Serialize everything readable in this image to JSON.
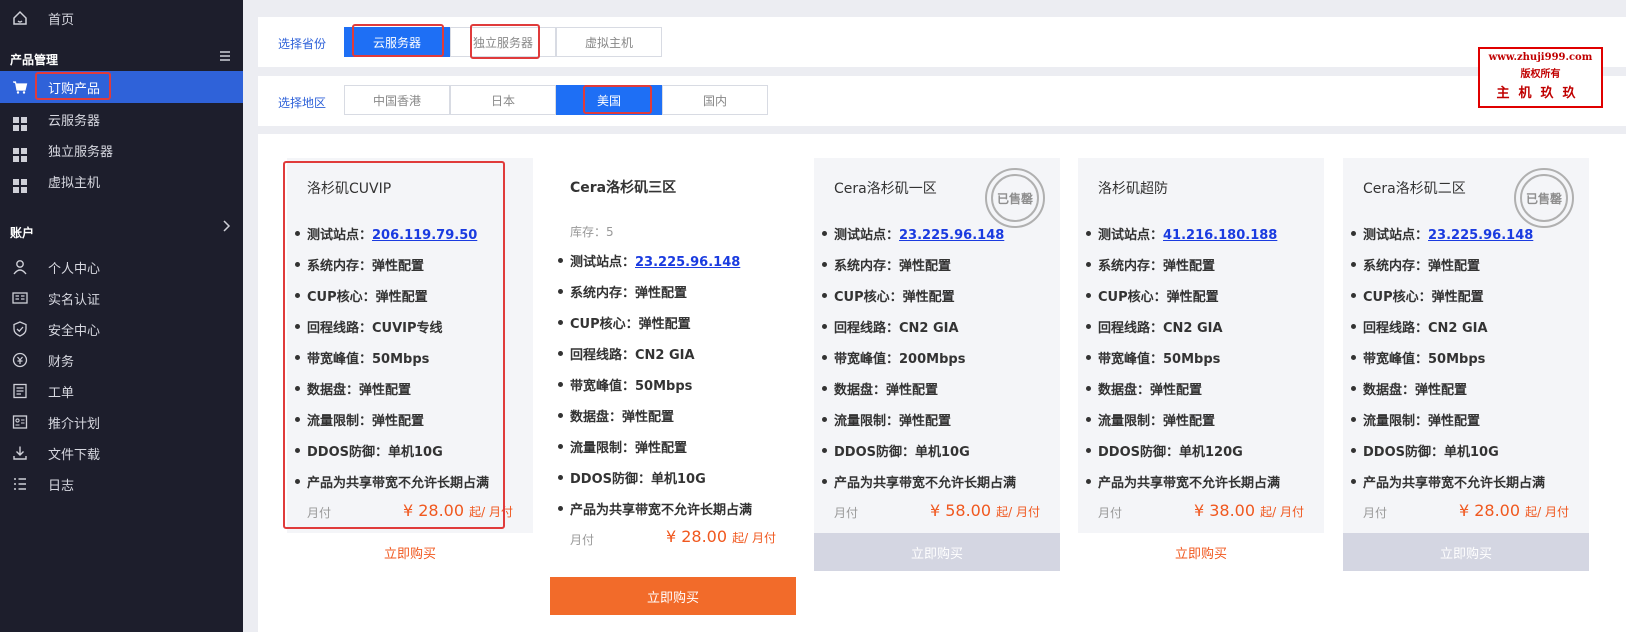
{
  "sidebar": {
    "home": "首页",
    "product_section": "产品管理",
    "items": [
      {
        "label": "订购产品"
      },
      {
        "label": "云服务器"
      },
      {
        "label": "独立服务器"
      },
      {
        "label": "虚拟主机"
      }
    ],
    "account_section": "账户",
    "account_items": [
      {
        "label": "个人中心"
      },
      {
        "label": "实名认证"
      },
      {
        "label": "安全中心"
      },
      {
        "label": "财务"
      },
      {
        "label": "工单"
      },
      {
        "label": "推介计划"
      },
      {
        "label": "文件下载"
      },
      {
        "label": "日志"
      }
    ]
  },
  "filters": {
    "type_label": "选择省份",
    "type_options": [
      "云服务器",
      "独立服务器",
      "虚拟主机"
    ],
    "type_selected": "云服务器",
    "region_label": "选择地区",
    "region_options": [
      "中国香港",
      "日本",
      "美国",
      "国内"
    ],
    "region_selected": "美国"
  },
  "watermark": {
    "line1": "www.zhuji999.com",
    "line2": "版权所有",
    "line3": "主机玖玖"
  },
  "spec_labels": {
    "site": "测试站点：",
    "memory": "系统内存：",
    "cpu": "CUP核心：",
    "route": "回程线路：",
    "bandwidth": "带宽峰值：",
    "disk": "数据盘：",
    "traffic": "流量限制：",
    "ddos": "DDOS防御：",
    "note": "产品为共享带宽不允许长期占满"
  },
  "price_suffix": "起/ 月付",
  "cards": [
    {
      "title": "洛杉矶CUVIP",
      "stock": "",
      "site": "206.119.79.50",
      "memory": "弹性配置",
      "cpu": "弹性配置",
      "route": "CUVIP专线",
      "bandwidth": "50Mbps",
      "disk": "弹性配置",
      "traffic": "弹性配置",
      "ddos": "单机10G",
      "cycle": "月付",
      "price": "¥ 28.00",
      "buy": "立即购买",
      "sold": ""
    },
    {
      "title": "Cera洛杉矶三区",
      "stock": "库存：5",
      "site": "23.225.96.148",
      "memory": "弹性配置",
      "cpu": "弹性配置",
      "route": "CN2 GIA",
      "bandwidth": "50Mbps",
      "disk": "弹性配置",
      "traffic": "弹性配置",
      "ddos": "单机10G",
      "cycle": "月付",
      "price": "¥ 28.00",
      "buy": "立即购买",
      "sold": ""
    },
    {
      "title": "Cera洛杉矶一区",
      "stock": "",
      "site": "23.225.96.148",
      "memory": "弹性配置",
      "cpu": "弹性配置",
      "route": "CN2 GIA",
      "bandwidth": "200Mbps",
      "disk": "弹性配置",
      "traffic": "弹性配置",
      "ddos": "单机10G",
      "cycle": "月付",
      "price": "¥ 58.00",
      "buy": "立即购买",
      "sold": "已售罄"
    },
    {
      "title": "洛杉矶超防",
      "stock": "",
      "site": "41.216.180.188",
      "memory": "弹性配置",
      "cpu": "弹性配置",
      "route": "CN2 GIA",
      "bandwidth": "50Mbps",
      "disk": "弹性配置",
      "traffic": "弹性配置",
      "ddos": "单机120G",
      "cycle": "月付",
      "price": "¥ 38.00",
      "buy": "立即购买",
      "sold": ""
    },
    {
      "title": "Cera洛杉矶二区",
      "stock": "",
      "site": "23.225.96.148",
      "memory": "弹性配置",
      "cpu": "弹性配置",
      "route": "CN2 GIA",
      "bandwidth": "50Mbps",
      "disk": "弹性配置",
      "traffic": "弹性配置",
      "ddos": "单机10G",
      "cycle": "月付",
      "price": "¥ 28.00",
      "buy": "立即购买",
      "sold": "已售罄"
    }
  ],
  "icons": {
    "home": "home-icon",
    "cart": "cart-icon",
    "grid": "grid-icon",
    "user": "user-icon",
    "idcard": "id-card-icon",
    "shield": "shield-icon",
    "finance": "finance-icon",
    "ticket": "ticket-icon",
    "referral": "referral-icon",
    "download": "download-icon",
    "log": "log-icon"
  },
  "colors": {
    "sidebar_bg": "#1d1e2c",
    "active_blue": "#2f62d9",
    "seg_active": "#1e6ff5",
    "price_orange": "#f0581f",
    "buy_orange": "#f26b2a",
    "highlight_red": "#e03b3b"
  }
}
